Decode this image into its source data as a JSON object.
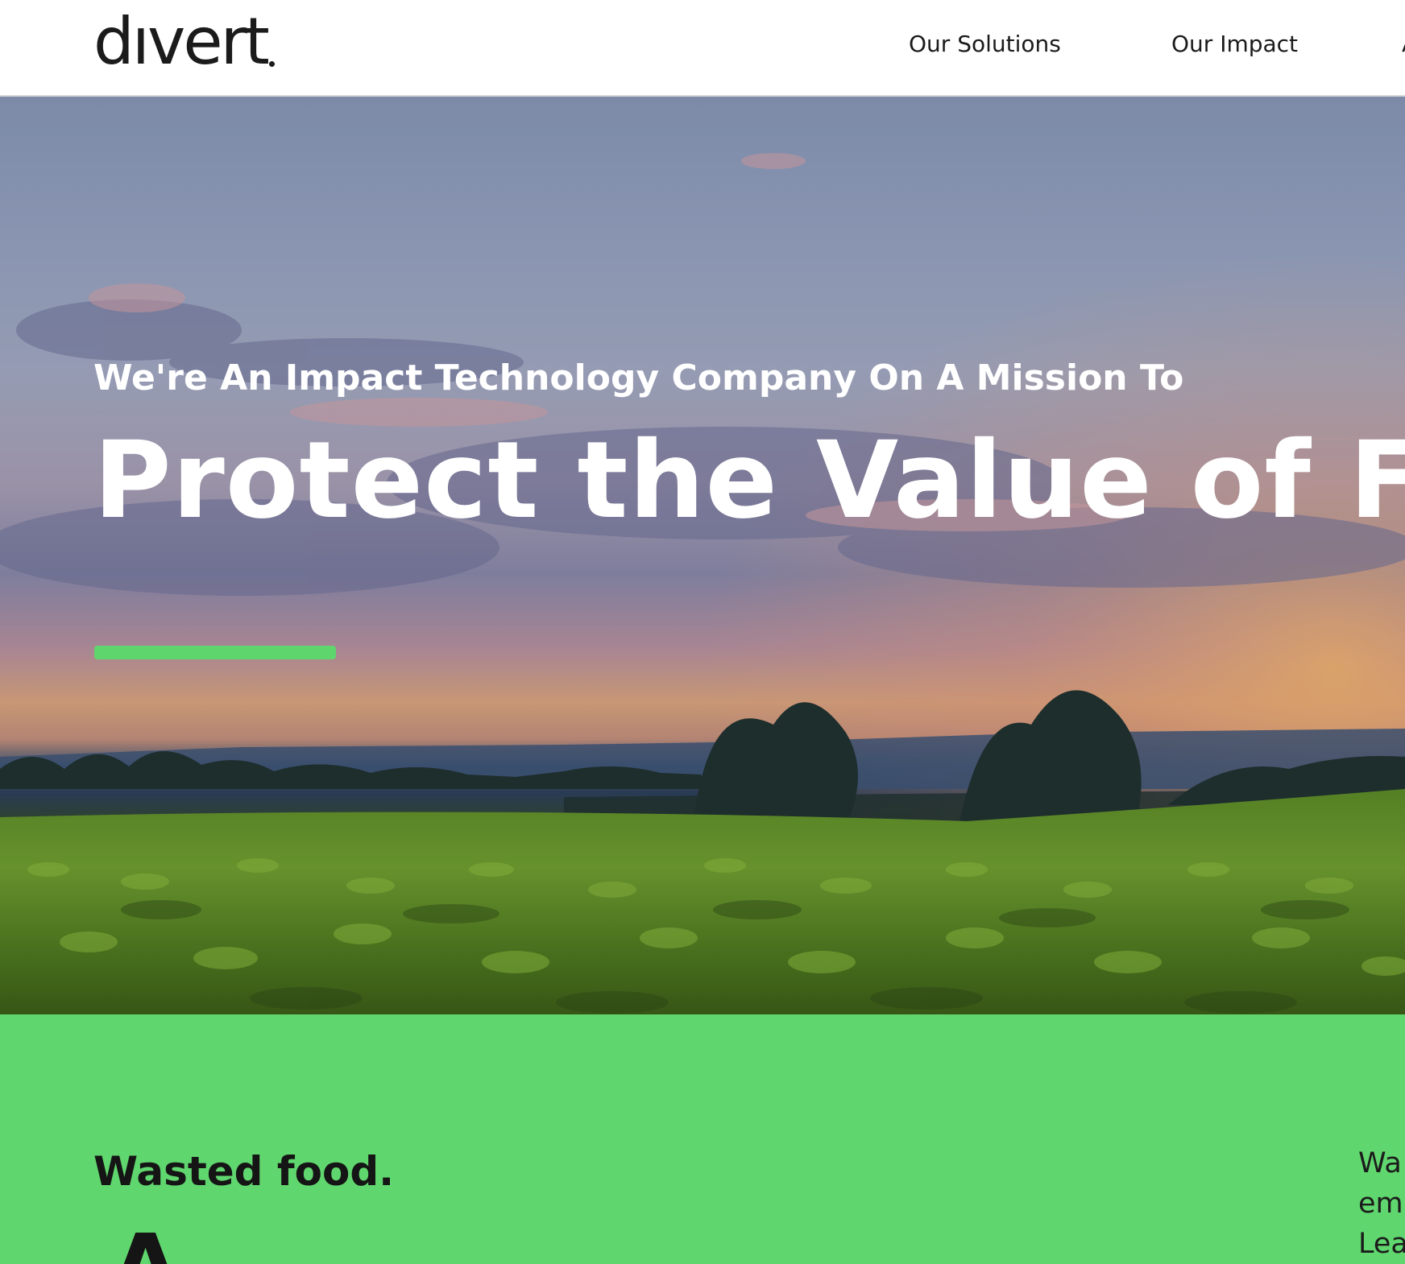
{
  "header": {
    "logo_text": "dıvert",
    "nav": [
      {
        "label": "Our Solutions"
      },
      {
        "label": "Our Impact"
      },
      {
        "label": "A"
      }
    ]
  },
  "hero": {
    "kicker": "We're An Impact Technology Company On A Mission To",
    "title": "Protect the Value of Foo",
    "accent_color": "#5fd56d"
  },
  "intro": {
    "heading": "Wasted food.",
    "big_text": "A",
    "side_lines": [
      "Wa",
      "emi",
      "Lea"
    ]
  },
  "colors": {
    "brand_green": "#60d66e",
    "text_dark": "#1b1b1b"
  }
}
